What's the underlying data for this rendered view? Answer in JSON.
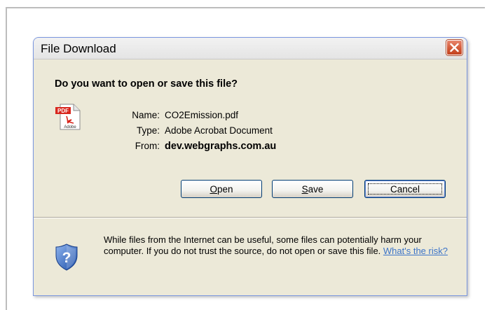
{
  "dialog": {
    "title": "File Download",
    "question": "Do you want to open or save this file?",
    "file": {
      "name_label": "Name:",
      "name_value": "CO2Emission.pdf",
      "type_label": "Type:",
      "type_value": "Adobe Acrobat Document",
      "from_label": "From:",
      "from_value": "dev.webgraphs.com.au",
      "icon": "pdf-file-icon",
      "icon_badge": "PDF",
      "icon_caption": "Adobe"
    },
    "buttons": {
      "open": {
        "accel": "O",
        "rest": "pen"
      },
      "save": {
        "accel": "S",
        "rest": "ave"
      },
      "cancel": "Cancel"
    },
    "warning": {
      "text": "While files from the Internet can be useful, some files can potentially harm your computer. If you do not trust the source, do not open or save this file.",
      "link": "What's the risk?",
      "icon": "shield-question-icon"
    },
    "colors": {
      "close_button": "#d35a38",
      "link": "#3c74c8",
      "dialog_body": "#ece9d8"
    }
  }
}
